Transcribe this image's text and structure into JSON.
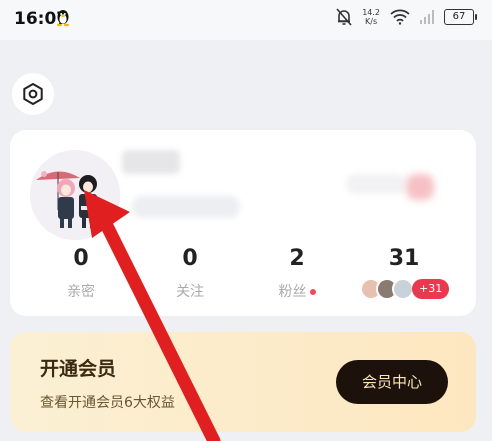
{
  "status_bar": {
    "time": "16:07",
    "net_speed_value": "14.2",
    "net_speed_unit": "K/s",
    "battery": "67"
  },
  "profile": {
    "stats": [
      {
        "value": "0",
        "label": "亲密"
      },
      {
        "value": "0",
        "label": "关注"
      },
      {
        "value": "2",
        "label": "粉丝"
      },
      {
        "value": "31",
        "label": ""
      }
    ],
    "visitor_badge": "+31"
  },
  "vip": {
    "title": "开通会员",
    "subtitle": "查看开通会员6大权益",
    "button_label": "会员中心"
  },
  "colors": {
    "accent_red": "#e8394f",
    "vip_bg": "#fbe9c4",
    "vip_button": "#1c120b"
  }
}
